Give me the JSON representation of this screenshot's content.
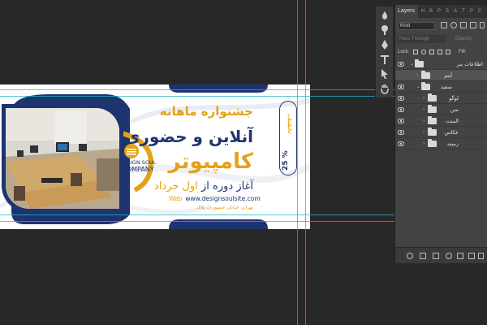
{
  "panel": {
    "tab_active": "Layers",
    "tab_glyphs": [
      "H",
      "B",
      "P",
      "S",
      "A",
      "T",
      "P",
      "C"
    ],
    "filter_kind": "Kind",
    "blend_mode": "Pass Through",
    "opacity_label": "Opacity:",
    "lock_label": "Lock:",
    "fill_label": "Fill:",
    "layers": [
      {
        "name": "اطلاعات بنر",
        "indent": 0,
        "expanded": true,
        "visible": true,
        "selected": false
      },
      {
        "name": "آیتم",
        "indent": 1,
        "expanded": false,
        "visible": false,
        "selected": true
      },
      {
        "name": "سفید",
        "indent": 1,
        "expanded": true,
        "visible": true,
        "selected": false
      },
      {
        "name": "لوگو",
        "indent": 2,
        "expanded": false,
        "visible": true,
        "selected": false
      },
      {
        "name": "متن",
        "indent": 2,
        "expanded": false,
        "visible": true,
        "selected": false
      },
      {
        "name": "المنت",
        "indent": 2,
        "expanded": false,
        "visible": true,
        "selected": false
      },
      {
        "name": "عکاس",
        "indent": 2,
        "expanded": false,
        "visible": true,
        "selected": false
      },
      {
        "name": "زمینه",
        "indent": 2,
        "expanded": false,
        "visible": true,
        "selected": false
      }
    ]
  },
  "banner": {
    "headline_1": "جشنواره ماهانه",
    "headline_2": "آنلاین و حضوری",
    "headline_3": "کامپیوتر",
    "start_prefix": "آغاز دوره از",
    "start_month": "اول خرداد",
    "web_label": "Web",
    "website": "www.designsoulsite.com",
    "address": "تهران، خیابان جمهوری، پلاک",
    "discount_word": "تخفیف",
    "discount_value": "25 %",
    "logo_line1": "DESIGN SOUL",
    "logo_line2": "COMPANY"
  },
  "colors": {
    "navy": "#1d3470",
    "gold": "#e3a21a",
    "workspace": "#282828",
    "panel": "#434343",
    "guide": "#18b7c7"
  }
}
